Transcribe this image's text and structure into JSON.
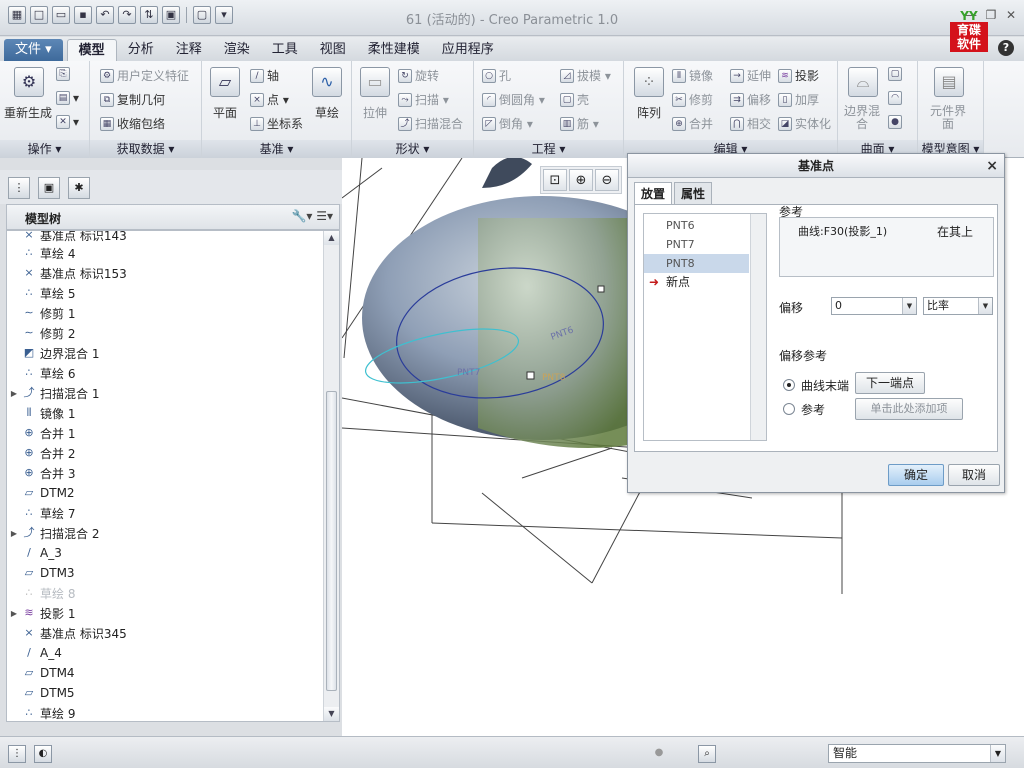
{
  "window": {
    "title": "61 (活动的) - Creo Parametric 1.0",
    "brand_top": "YY",
    "brand_line1": "育碟",
    "brand_line2": "软件"
  },
  "tabs": [
    "文件 ▾",
    "模型",
    "分析",
    "注释",
    "渲染",
    "工具",
    "视图",
    "柔性建模",
    "应用程序"
  ],
  "ribbon": {
    "operations": {
      "label": "操作 ▾",
      "regen": "重新生成"
    },
    "get_data": {
      "label": "获取数据 ▾",
      "items": [
        "用户定义特征",
        "复制几何",
        "收缩包络"
      ]
    },
    "datum": {
      "label": "基准 ▾",
      "plane": "平面",
      "axis": "轴",
      "point": "点 ▾",
      "csys": "坐标系",
      "sketch": "草绘"
    },
    "shapes": {
      "label": "形状 ▾",
      "extrude": "拉伸",
      "revolve": "旋转",
      "sweep": "扫描 ▾",
      "swept_blend": "扫描混合"
    },
    "engineering": {
      "label": "工程 ▾",
      "items": [
        "孔",
        "倒圆角 ▾",
        "倒角 ▾",
        "拔模 ▾",
        "壳",
        "筋 ▾"
      ]
    },
    "editing": {
      "label": "编辑 ▾",
      "pattern": "阵列",
      "items": [
        "镜像",
        "修剪",
        "合并",
        "延伸",
        "偏移",
        "相交",
        "投影",
        "加厚",
        "实体化"
      ]
    },
    "surfaces": {
      "label": "曲面 ▾",
      "boundary": "边界混合"
    },
    "model_intent": {
      "label": "模型意图 ▾",
      "component": "元件界面"
    }
  },
  "model_tree": {
    "title": "模型树",
    "items": [
      {
        "label": "基准点 标识143",
        "icon": "datum-point-icon"
      },
      {
        "label": "草绘 4",
        "icon": "sketch-icon"
      },
      {
        "label": "基准点 标识153",
        "icon": "datum-point-icon"
      },
      {
        "label": "草绘 5",
        "icon": "sketch-icon"
      },
      {
        "label": "修剪 1",
        "icon": "trim-icon"
      },
      {
        "label": "修剪 2",
        "icon": "trim-icon"
      },
      {
        "label": "边界混合 1",
        "icon": "boundary-blend-icon"
      },
      {
        "label": "草绘 6",
        "icon": "sketch-icon"
      },
      {
        "label": "扫描混合 1",
        "icon": "swept-blend-icon"
      },
      {
        "label": "镜像 1",
        "icon": "mirror-icon"
      },
      {
        "label": "合并 1",
        "icon": "merge-icon"
      },
      {
        "label": "合并 2",
        "icon": "merge-icon"
      },
      {
        "label": "合并 3",
        "icon": "merge-icon"
      },
      {
        "label": "DTM2",
        "icon": "datum-plane-icon"
      },
      {
        "label": "草绘 7",
        "icon": "sketch-icon"
      },
      {
        "label": "扫描混合 2",
        "icon": "swept-blend-icon"
      },
      {
        "label": "A_3",
        "icon": "datum-axis-icon"
      },
      {
        "label": "DTM3",
        "icon": "datum-plane-icon"
      },
      {
        "label": "草绘 8",
        "icon": "sketch-icon"
      },
      {
        "label": "投影 1",
        "icon": "projection-icon"
      },
      {
        "label": "基准点 标识345",
        "icon": "datum-point-icon"
      },
      {
        "label": "A_4",
        "icon": "datum-axis-icon"
      },
      {
        "label": "DTM4",
        "icon": "datum-plane-icon"
      },
      {
        "label": "DTM5",
        "icon": "datum-plane-icon"
      },
      {
        "label": "草绘 9",
        "icon": "sketch-icon"
      }
    ]
  },
  "graphics": {
    "labels": {
      "pnt7": "PNT7",
      "pnt8": "PNT8",
      "pnt6": "PNT6"
    }
  },
  "dialog": {
    "title": "基准点",
    "tabs": [
      "放置",
      "属性"
    ],
    "points": [
      "PNT6",
      "PNT7",
      "PNT8",
      "新点"
    ],
    "reference_label": "参考",
    "reference_value": "曲线:F30(投影_1)",
    "reference_type": "在其上",
    "offset_label": "偏移",
    "offset_value": "0",
    "offset_mode": "比率",
    "offset_ref_label": "偏移参考",
    "radio_curve_end": "曲线末端",
    "next_end_button": "下一端点",
    "radio_reference": "参考",
    "add_item_placeholder": "单击此处添加项",
    "ok_button": "确定",
    "cancel_button": "取消"
  },
  "statusbar": {
    "filter_value": "智能"
  }
}
